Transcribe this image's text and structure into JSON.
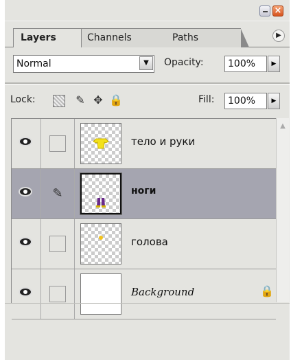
{
  "tabs": [
    "Layers",
    "Channels",
    "Paths"
  ],
  "blend_mode": "Normal",
  "opacity": {
    "label": "Opacity:",
    "value": "100%"
  },
  "lock_label": "Lock:",
  "fill": {
    "label": "Fill:",
    "value": "100%"
  },
  "layers": [
    {
      "name": "тело и руки",
      "visible": true,
      "selected": false
    },
    {
      "name": "ноги",
      "visible": true,
      "selected": true
    },
    {
      "name": "голова",
      "visible": true,
      "selected": false
    },
    {
      "name": "Background",
      "visible": true,
      "selected": false,
      "locked": true
    }
  ],
  "colors": {
    "selected_row": "#a5a5b0",
    "panel_bg": "#e4e4e0",
    "close_button": "#e0662e"
  }
}
